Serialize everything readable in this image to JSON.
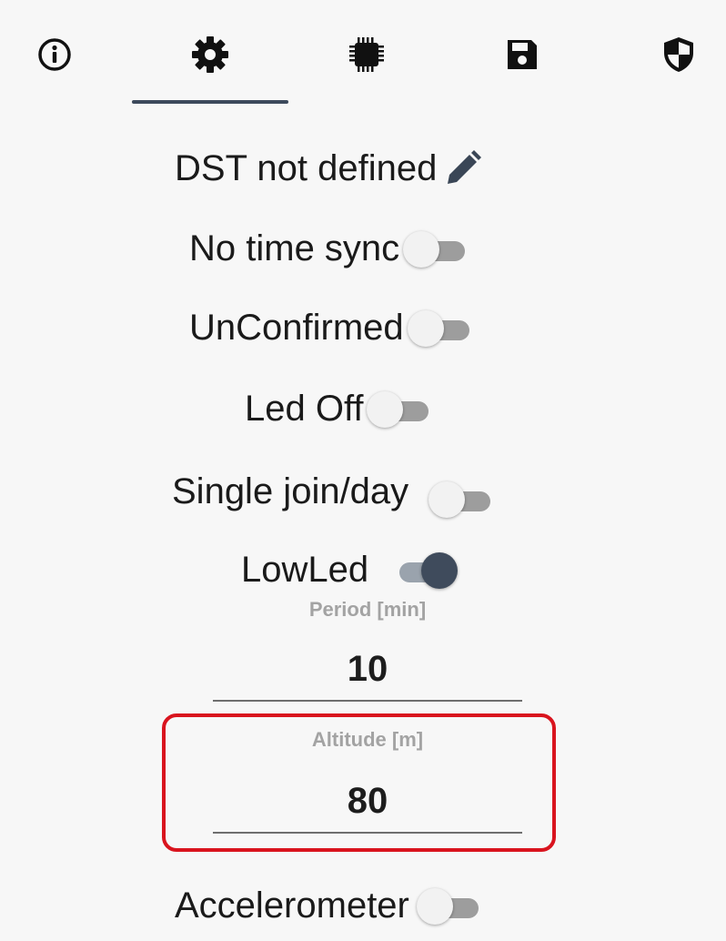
{
  "tabs": [
    {
      "icon": "info-icon"
    },
    {
      "icon": "gear-icon",
      "selected": true
    },
    {
      "icon": "chip-icon"
    },
    {
      "icon": "save-icon"
    },
    {
      "icon": "shield-icon"
    }
  ],
  "colors": {
    "accent": "#3d4a5c",
    "highlight": "#d9141e",
    "switch_off_track": "#9d9d9d",
    "switch_on_thumb": "#3f4b5c"
  },
  "settings": {
    "dst": {
      "label": "DST not defined",
      "icon": "pencil-icon"
    },
    "time_sync": {
      "label": "No time sync",
      "on": false
    },
    "confirmed": {
      "label": "UnConfirmed",
      "on": false
    },
    "led": {
      "label": "Led Off",
      "on": false
    },
    "single_join": {
      "label": "Single join/day",
      "on": false
    },
    "low_led": {
      "label": "LowLed",
      "on": true
    },
    "period": {
      "label": "Period [min]",
      "value": "10"
    },
    "altitude": {
      "label": "Altitude [m]",
      "value": "80"
    },
    "accelerometer": {
      "label": "Accelerometer",
      "on": false
    }
  }
}
